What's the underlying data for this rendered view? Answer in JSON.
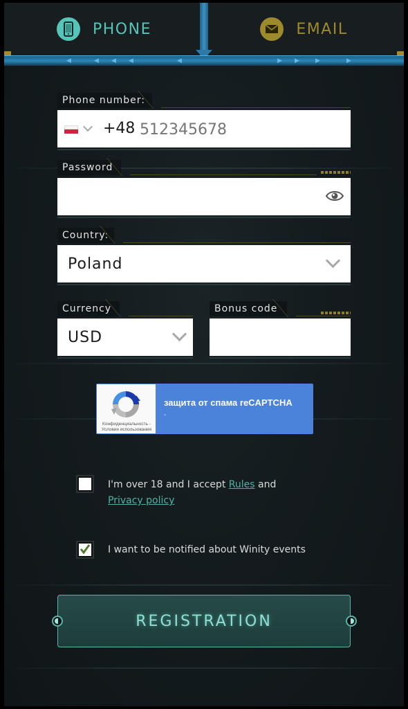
{
  "tabs": {
    "phone": {
      "label": "PHONE",
      "icon": "mobile-phone-icon",
      "color": "#56c4b8"
    },
    "email": {
      "label": "EMAIL",
      "icon": "envelope-icon",
      "color": "#9c8a2c"
    }
  },
  "phone_field": {
    "label": "Phone number:",
    "flag": "poland-flag-icon",
    "code": "+48",
    "placeholder": "512345678"
  },
  "password_field": {
    "label": "Password",
    "value": "",
    "toggle_icon": "eye-icon"
  },
  "country_field": {
    "label": "Country:",
    "value": "Poland"
  },
  "currency_field": {
    "label": "Currency",
    "value": "USD"
  },
  "bonus_field": {
    "label": "Bonus code",
    "value": ""
  },
  "recaptcha": {
    "title": "защита от спама reCAPTCHA",
    "subtitle": "-",
    "privacy": "Конфиденциальность -",
    "terms": "Условия использования"
  },
  "consent": {
    "age_text_prefix": "I'm over 18 and I accept ",
    "rules_link": "Rules",
    "age_text_middle": " and",
    "privacy_link": "Privacy policy",
    "age_checked": false,
    "notify_text": "I want to be notified about Winity events",
    "notify_checked": true
  },
  "register_button": {
    "label": "REGISTRATION"
  },
  "colors": {
    "accent": "#56c4b8",
    "gold": "#9c8a2c",
    "blue": "#2c87b8",
    "background": "#141b1e"
  }
}
